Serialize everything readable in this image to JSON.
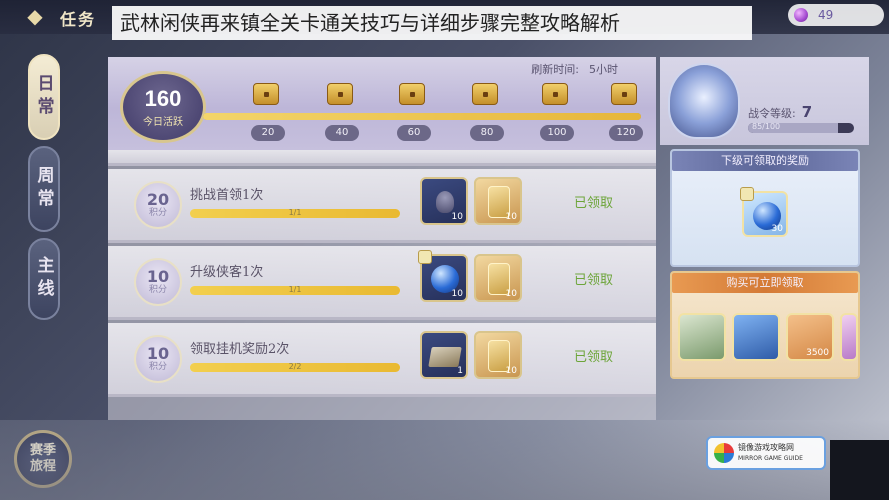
{
  "topbar": {
    "back_label": "◆",
    "title": "任务",
    "currency_value": "49"
  },
  "caption": "武林闲侠再来镇全关卡通关技巧与详细步骤完整攻略解析",
  "left_tabs": {
    "daily": "日常",
    "weekly": "周常",
    "main": "主线"
  },
  "season_button": {
    "line1": "赛季",
    "line2": "旅程"
  },
  "activity": {
    "value": "160",
    "label": "今日活跃",
    "refresh_label": "刷新时间:",
    "refresh_value": "5小时",
    "progress_fraction": 1.0,
    "milestones": [
      "20",
      "40",
      "60",
      "80",
      "100",
      "120"
    ]
  },
  "tasks": [
    {
      "points": "20",
      "unit": "积分",
      "name": "挑战首领1次",
      "progress": "1/1",
      "progress_fraction": 1.0,
      "reward_a_count": "10",
      "reward_b_count": "10",
      "status": "已领取"
    },
    {
      "points": "10",
      "unit": "积分",
      "name": "升级侠客1次",
      "progress": "1/1",
      "progress_fraction": 1.0,
      "reward_a_count": "10",
      "reward_b_count": "10",
      "status": "已领取"
    },
    {
      "points": "10",
      "unit": "积分",
      "name": "领取挂机奖励2次",
      "progress": "2/2",
      "progress_fraction": 1.0,
      "reward_a_count": "1",
      "reward_b_count": "10",
      "status": "已领取"
    }
  ],
  "battle_pass": {
    "level_label": "战令等级:",
    "level_value": "7",
    "exp_text": "85/100",
    "exp_fraction": 0.85,
    "next_reward_title": "下级可领取的奖励",
    "next_reward_count": "30",
    "buy_title": "购买可立即领取",
    "buy_item_count": "3500"
  },
  "watermark": {
    "line1": "镜像游戏攻略网",
    "line2": "MIRROR GAME GUIDE"
  },
  "colors": {
    "accent_gold": "#e9b932",
    "claimed_green": "#6da53a",
    "tab_active": "#f4ecd4"
  }
}
